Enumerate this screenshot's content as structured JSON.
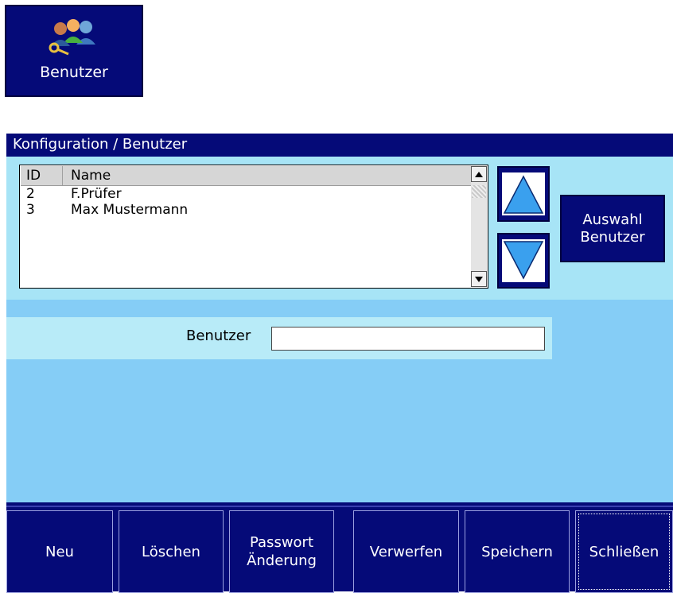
{
  "app_tile": {
    "label": "Benutzer",
    "icon": "users-key-icon"
  },
  "window": {
    "title": "Konfiguration / Benutzer"
  },
  "user_list": {
    "columns": [
      "ID",
      "Name"
    ],
    "rows": [
      {
        "id": "2",
        "name": "F.Prüfer"
      },
      {
        "id": "3",
        "name": "Max Mustermann"
      }
    ]
  },
  "buttons": {
    "up": "up-arrow-icon",
    "down": "down-arrow-icon",
    "auswahl_line1": "Auswahl",
    "auswahl_line2": "Benutzer"
  },
  "user_field": {
    "label": "Benutzer",
    "value": ""
  },
  "toolbar": {
    "neu": "Neu",
    "loeschen": "Löschen",
    "passwort_line1": "Passwort",
    "passwort_line2": "Änderung",
    "verwerfen": "Verwerfen",
    "speichern": "Speichern",
    "schliessen": "Schließen"
  },
  "colors": {
    "navy": "#050a78",
    "panel_light": "#a7e4f6",
    "panel_main": "#85cdf6",
    "arrow_blue": "#3aa0ee"
  }
}
